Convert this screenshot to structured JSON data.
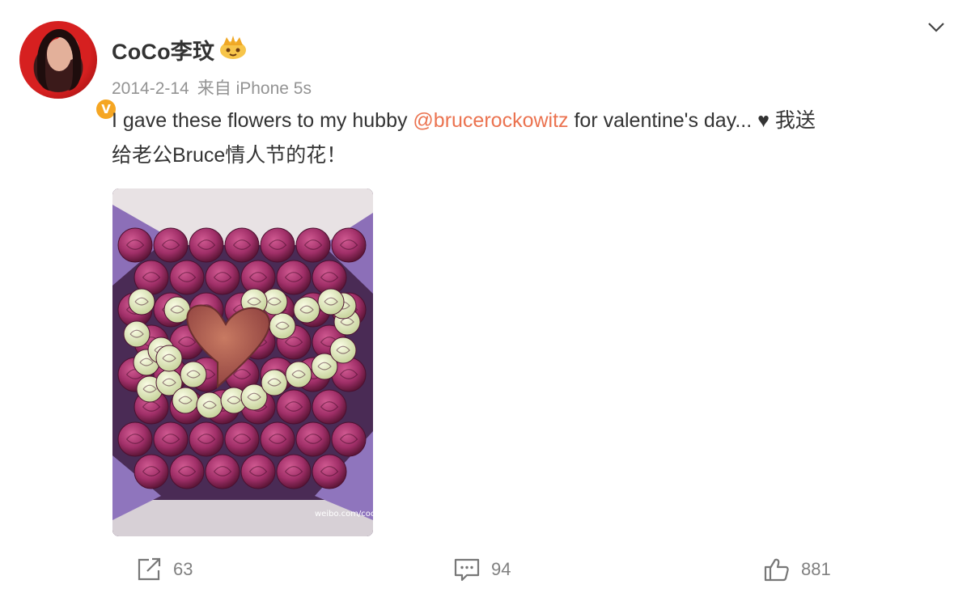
{
  "post": {
    "author": "CoCo李玟",
    "verified_badge": "V",
    "date": "2014-2-14",
    "source": "来自 iPhone 5s",
    "text_prefix": "I gave these flowers to my hubby ",
    "mention": "@brucerockowitz",
    "text_suffix": " for valentine's day... ",
    "heart_glyph": "♥",
    "text_chinese_1": " 我送",
    "text_chinese_2": "给老公Bruce情人节的花！",
    "image_watermark": "weibo.com/cocolee"
  },
  "actions": {
    "repost_count": "63",
    "comment_count": "94",
    "like_count": "881"
  },
  "colors": {
    "mention": "#eb7350",
    "meta": "#939393",
    "badge": "#f5a623"
  },
  "icons": [
    "vip-crown-icon",
    "chevron-down-icon",
    "repost-icon",
    "comment-icon",
    "like-icon"
  ]
}
